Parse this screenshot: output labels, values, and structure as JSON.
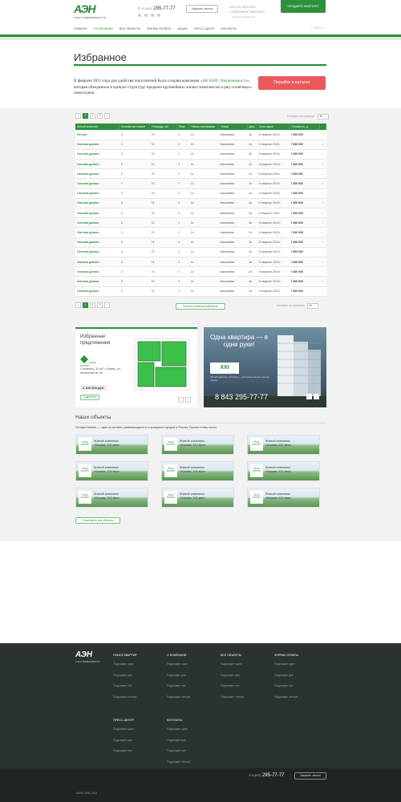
{
  "header": {
    "logo_mark": "АЭН",
    "logo_sub": "АГЕНТ НЕДВИЖИМОСТИ",
    "phone_code": "8 (843)",
    "phone_number": "295-77-77",
    "call_button": "Заказать звонок",
    "link_1": "ЧАСТНО-ЭЛИТНОЕ",
    "link_2": "ИЗБРАННЫЕ КВАРТИРЫ",
    "link_2_sub": "0 квартир добавлено",
    "sell_button": "ПРОДАЙТЕ КВАРТИРУ",
    "search_placeholder": "ПОИСК"
  },
  "nav": {
    "items": [
      "ГЛАВНАЯ",
      "О КОМПАНИИ",
      "ВСЕ ОБЪЕКТЫ",
      "ФОРМЫ ОПЛАТЫ",
      "АКЦИИ",
      "ПРЕСС-ЦЕНТР",
      "КОНТАКТЫ"
    ],
    "active": "О КОМПАНИИ"
  },
  "page": {
    "title": "Избранное",
    "intro_1": "В феврале 2011 года для удобства покупателей была создана компания",
    "intro_link": "«АК БАРС Недвижимость»",
    "intro_2": ", которая объединила в единую структуру продажи крупнейших жилых комплексов и ряд «точечных» новостроек.",
    "catalog_button": "Перейти в каталог"
  },
  "table": {
    "pages": [
      "1",
      "2",
      "3"
    ],
    "current_page": "1",
    "per_page_label": "Показать на странице:",
    "per_page_value": "40",
    "headers": [
      "Жилой комплекс",
      "Количество комнат",
      "Площадь, м2",
      "Этаж",
      "Номер платформы",
      "Улица",
      "Дом",
      "Срок сдачи",
      "Стоимость, р.",
      ""
    ],
    "rows": [
      [
        "XXI век",
        "3",
        "74",
        "2",
        "14",
        "Камалеева",
        "2а",
        "IV квартал 2015 г.",
        "7 400 000",
        "×"
      ],
      [
        "Светлая долина",
        "3",
        "74",
        "2",
        "14",
        "Камалеева",
        "2а",
        "IV квартал 2015 г.",
        "7 400 000",
        "×"
      ],
      [
        "Светлая долина",
        "3",
        "74",
        "2",
        "14",
        "Камалеева",
        "2а",
        "IV квартал 2015 г.",
        "7 400 000",
        "×"
      ],
      [
        "Светлая долина",
        "3",
        "74",
        "2",
        "14",
        "Камалеева",
        "2а",
        "IV квартал 2015 г.",
        "7 400 000",
        "×"
      ],
      [
        "Светлая долина",
        "3",
        "74",
        "2",
        "14",
        "Камалеева",
        "2а",
        "IV квартал 2015 г.",
        "7 400 000",
        "×"
      ],
      [
        "Светлая долина",
        "3",
        "74",
        "2",
        "14",
        "Камалеева",
        "2а",
        "IV квартал 2015 г.",
        "7 400 000",
        "×"
      ],
      [
        "Светлая долина",
        "3",
        "74",
        "2",
        "14",
        "Камалеева",
        "2а",
        "IV квартал 2015 г.",
        "7 400 000",
        "×"
      ],
      [
        "Светлая долина",
        "3",
        "74",
        "2",
        "14",
        "Камалеева",
        "2а",
        "IV квартал 2015 г.",
        "7 400 000",
        "×"
      ],
      [
        "Светлая долина",
        "3",
        "74",
        "2",
        "14",
        "Камалеева",
        "2а",
        "IV квартал 2015 г.",
        "7 400 000",
        "×"
      ],
      [
        "Светлая долина",
        "3",
        "74",
        "2",
        "14",
        "Камалеева",
        "2а",
        "IV квартал 2015 г.",
        "7 400 000",
        "×"
      ],
      [
        "Светлая долина",
        "3",
        "74",
        "2",
        "14",
        "Камалеева",
        "2а",
        "IV квартал 2015 г.",
        "7 400 000",
        "×"
      ],
      [
        "Светлая долина",
        "3",
        "74",
        "2",
        "14",
        "Камалеева",
        "2а",
        "IV квартал 2015 г.",
        "7 400 000",
        "×"
      ],
      [
        "Светлая долина",
        "3",
        "74",
        "2",
        "14",
        "Камалеева",
        "2а",
        "IV квартал 2015 г.",
        "7 400 000",
        "×"
      ],
      [
        "Светлая долина",
        "3",
        "74",
        "2",
        "14",
        "Камалеева",
        "2а",
        "IV квартал 2015 г.",
        "7 400 000",
        "×"
      ],
      [
        "Светлая долина",
        "3",
        "74",
        "2",
        "14",
        "Камалеева",
        "2а",
        "IV квартал 2015 г.",
        "7 400 000",
        "×"
      ],
      [
        "Светлая долина",
        "3",
        "74",
        "2",
        "14",
        "Камалеева",
        "2а",
        "IV квартал 2015 г.",
        "7 400 000",
        "×"
      ],
      [
        "Светлая долина",
        "3",
        "74",
        "2",
        "14",
        "Камалеева",
        "2а",
        "IV квартал 2015 г.",
        "7 400 000",
        "×"
      ]
    ],
    "clear_button": "Очистить список избранных"
  },
  "promo": {
    "title": "Избранные предложения",
    "logo": "ЛЕНД МАРКЕТ",
    "desc": "2 комнаты, 54 м2 г. Казань, ул. Космонавтов, 46",
    "price": "2 100 000 руб.",
    "more": "Подробнее",
    "prev": "‹",
    "next": "›",
    "banner_text": "Одна квартира — в одни руки!",
    "banner_logo": "XXI",
    "banner_small": "Жилой комплекс «XXI век» — доступное жильё в центре города.",
    "banner_phone": "8 843 295-77-77"
  },
  "objects": {
    "title": "Наши объекты",
    "intro": "Сегодня Казань — один из активно развивающихся и строящихся городов в России. Причин этому много.",
    "card_logo": "ЛЕНД МАРКЕТ",
    "card_text_1": "Жилой комплекс",
    "card_text_2": "«Казань XXI век»",
    "show_all": "Посмотреть все объекты"
  },
  "footer": {
    "logo_mark": "АЭН",
    "logo_sub": "АГЕНТ НЕДВИЖИМОСТИ",
    "col1_title": "ПОИСК КВАРТИР",
    "col1_items": [
      "Подраздел один",
      "Подраздел два",
      "Подраздел три",
      "Подраздел четыре"
    ],
    "col2_title": "О КОМПАНИИ",
    "col2_items": [
      "Подраздел один",
      "Подраздел два",
      "Подраздел три",
      "Подраздел четыре"
    ],
    "col3_title": "ВСЕ ОБЪЕКТЫ",
    "col3_items": [
      "Подраздел один",
      "Подраздел два",
      "Подраздел три",
      "Подраздел четыре"
    ],
    "col4_title": "ФОРМЫ ОПЛАТЫ",
    "col4_items": [
      "Подраздел один",
      "Подраздел два",
      "Подраздел три",
      "Подраздел четыре"
    ],
    "col5_title": "ПРЕСС-ЦЕНТР",
    "col5_items": [
      "Подраздел один",
      "Подраздел два",
      "Подраздел три"
    ],
    "col6_title": "КОНТАКТЫ",
    "col6_items": [
      "Подраздел один",
      "Подраздел два",
      "Подраздел три",
      "Подраздел четыре"
    ],
    "phone_code": "8 (843)",
    "phone_number": "295-77-77",
    "call_button": "Заказать звонок",
    "copyright": "«АЭН» 2008–2014"
  },
  "colors": {
    "accent": "#2f8f3c",
    "cta": "#e95a5a",
    "footer": "#2b332d"
  }
}
